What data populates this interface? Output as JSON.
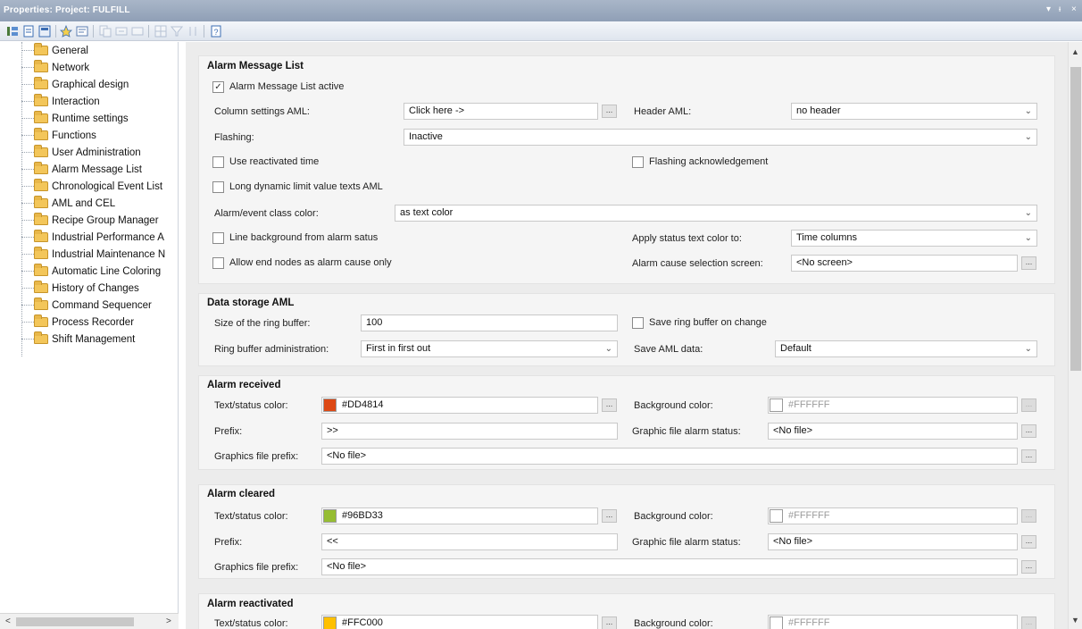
{
  "window": {
    "title": "Properties: Project: FULFILL",
    "controls": [
      "▾",
      "ᵻ",
      "×"
    ]
  },
  "tree": {
    "items": [
      "General",
      "Network",
      "Graphical design",
      "Interaction",
      "Runtime settings",
      "Functions",
      "User Administration",
      "Alarm Message List",
      "Chronological Event List",
      "AML and CEL",
      "Recipe Group Manager",
      "Industrial Performance A",
      "Industrial Maintenance N",
      "Automatic Line Coloring",
      "History of Changes",
      "Command Sequencer",
      "Process Recorder",
      "Shift Management"
    ],
    "scroll_left": "<",
    "scroll_right": ">"
  },
  "aml": {
    "title": "Alarm Message List",
    "active_label": "Alarm Message List active",
    "active_checked": "✓",
    "column_settings_label": "Column settings AML:",
    "column_settings_value": "Click here ->",
    "header_label": "Header AML:",
    "header_value": "no header",
    "flashing_label": "Flashing:",
    "flashing_value": "Inactive",
    "use_reactivated_label": "Use reactivated time",
    "flashing_ack_label": "Flashing acknowledgement",
    "long_dynamic_label": "Long dynamic limit value texts AML",
    "class_color_label": "Alarm/event class color:",
    "class_color_value": "as text color",
    "line_bg_label": "Line background from alarm satus",
    "apply_status_label": "Apply status text color to:",
    "apply_status_value": "Time columns",
    "allow_end_label": "Allow end nodes as alarm cause only",
    "cause_screen_label": "Alarm cause selection screen:",
    "cause_screen_value": "<No screen>"
  },
  "storage": {
    "title": "Data storage AML",
    "ring_size_label": "Size of the ring buffer:",
    "ring_size_value": "100",
    "save_ring_label": "Save ring buffer on change",
    "ring_admin_label": "Ring buffer administration:",
    "ring_admin_value": "First in first out",
    "save_data_label": "Save AML data:",
    "save_data_value": "Default"
  },
  "received": {
    "title": "Alarm received",
    "text_color_label": "Text/status color:",
    "text_color_value": "#DD4814",
    "bg_color_label": "Background color:",
    "bg_color_value": "#FFFFFF",
    "prefix_label": "Prefix:",
    "prefix_value": ">>",
    "graphic_status_label": "Graphic file alarm status:",
    "graphic_status_value": "<No file>",
    "graphics_prefix_label": "Graphics file prefix:",
    "graphics_prefix_value": "<No file>"
  },
  "cleared": {
    "title": "Alarm cleared",
    "text_color_label": "Text/status color:",
    "text_color_value": "#96BD33",
    "bg_color_label": "Background color:",
    "bg_color_value": "#FFFFFF",
    "prefix_label": "Prefix:",
    "prefix_value": "<<",
    "graphic_status_label": "Graphic file alarm status:",
    "graphic_status_value": "<No file>",
    "graphics_prefix_label": "Graphics file prefix:",
    "graphics_prefix_value": "<No file>"
  },
  "reactivated": {
    "title": "Alarm reactivated",
    "text_color_label": "Text/status color:",
    "text_color_value": "#FFC000",
    "bg_color_label": "Background color:",
    "bg_color_value": "#FFFFFF"
  },
  "common": {
    "ellipsis": "...",
    "caret": "⌄",
    "up": "▲",
    "down": "▼"
  },
  "colors": {
    "received": "#DD4814",
    "cleared": "#96BD33",
    "reactivated": "#FFC000",
    "background": "#FFFFFF"
  }
}
